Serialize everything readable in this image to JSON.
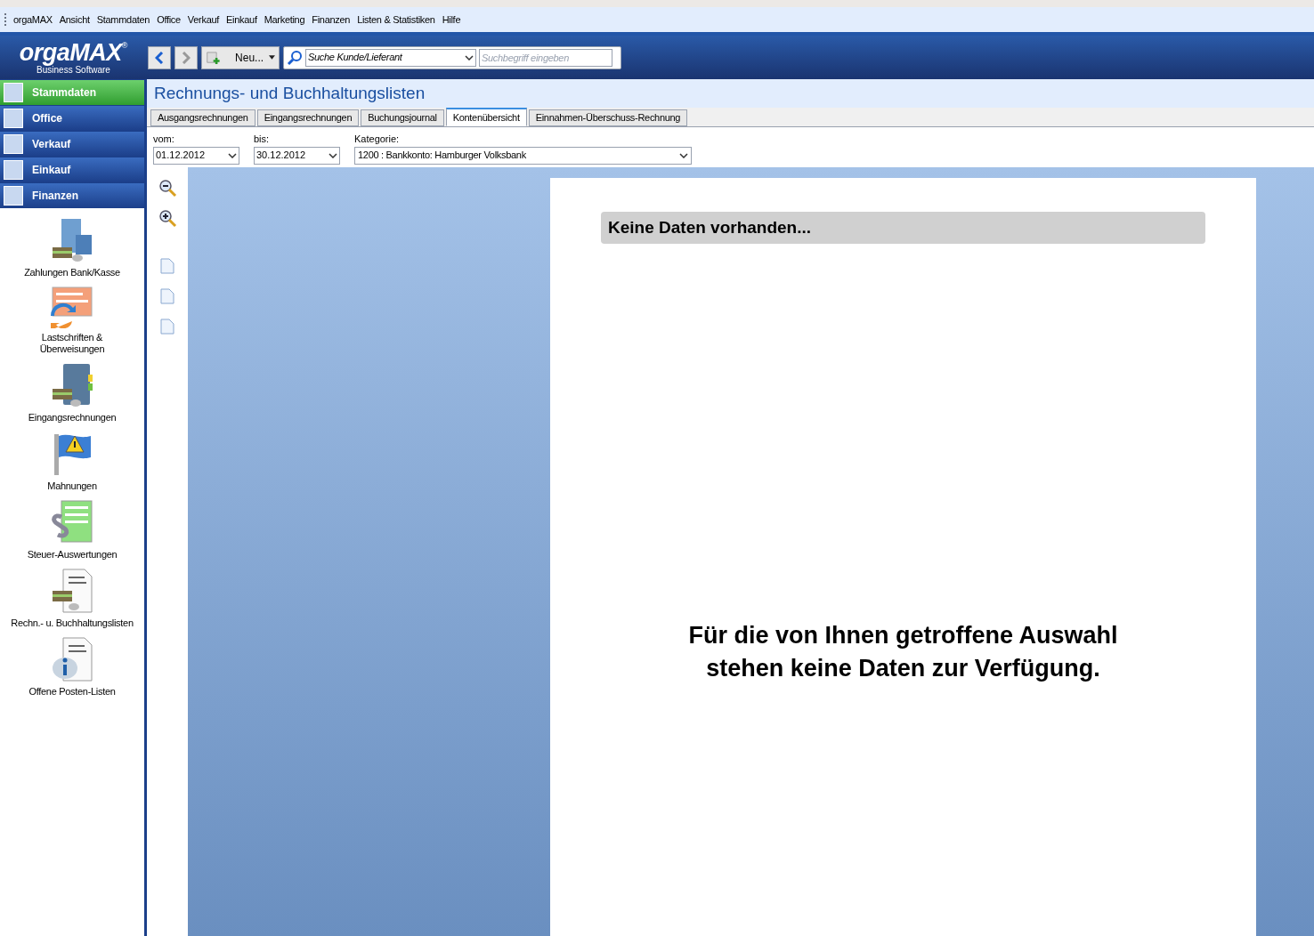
{
  "menu": [
    "orgaMAX",
    "Ansicht",
    "Stammdaten",
    "Office",
    "Verkauf",
    "Einkauf",
    "Marketing",
    "Finanzen",
    "Listen & Statistiken",
    "Hilfe"
  ],
  "logo": {
    "name": "orgaMAX",
    "mark": "®",
    "subtitle": "Business Software"
  },
  "toolbar": {
    "new_button": "Neu...",
    "search_type": "Suche Kunde/Lieferant",
    "search_placeholder": "Suchbegriff eingeben"
  },
  "nav": [
    {
      "label": "Stammdaten",
      "selected": true
    },
    {
      "label": "Office",
      "selected": false
    },
    {
      "label": "Verkauf",
      "selected": false
    },
    {
      "label": "Einkauf",
      "selected": false
    },
    {
      "label": "Finanzen",
      "selected": false
    }
  ],
  "modules": [
    {
      "label": "Zahlungen Bank/Kasse",
      "kind": "bank"
    },
    {
      "label": "Lastschriften & Überweisungen",
      "kind": "transfer"
    },
    {
      "label": "Eingangsrechnungen",
      "kind": "folder"
    },
    {
      "label": "Mahnungen",
      "kind": "flag"
    },
    {
      "label": "Steuer-Auswertungen",
      "kind": "tax"
    },
    {
      "label": "Rechn.- u. Buchhaltungslisten",
      "kind": "list"
    },
    {
      "label": "Offene Posten-Listen",
      "kind": "info"
    }
  ],
  "page_title": "Rechnungs- und Buchhaltungslisten",
  "tabs": [
    {
      "label": "Ausgangsrechnungen",
      "selected": false
    },
    {
      "label": "Eingangsrechnungen",
      "selected": false
    },
    {
      "label": "Buchungsjournal",
      "selected": false
    },
    {
      "label": "Kontenübersicht",
      "selected": true
    },
    {
      "label": "Einnahmen-Überschuss-Rechnung",
      "selected": false
    }
  ],
  "filters": {
    "from_label": "vom:",
    "from": "01.12.2012",
    "to_label": "bis:",
    "to": "30.12.2012",
    "category_label": "Kategorie:",
    "category": "1200 : Bankkonto: Hamburger Volksbank"
  },
  "report": {
    "heading": "Keine Daten vorhanden...",
    "message_lines": [
      "Für die von Ihnen getroffene Auswahl",
      "stehen keine Daten zur Verfügung."
    ]
  }
}
